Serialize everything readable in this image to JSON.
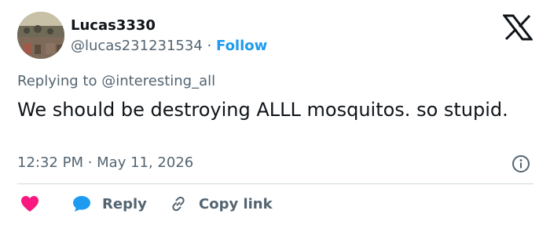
{
  "author": {
    "display_name": "Lucas3330",
    "handle": "@lucas231231534",
    "separator": "·",
    "follow_label": "Follow"
  },
  "reply_context": {
    "prefix": "Replying to",
    "target": "@interesting_all"
  },
  "tweet": {
    "text": "We should be destroying ALLL mosquitos. so stupid.",
    "timestamp": "12:32 PM · May 11, 2026"
  },
  "actions": {
    "reply_label": "Reply",
    "copy_link_label": "Copy link"
  },
  "colors": {
    "accent": "#1d9bf0",
    "heart": "#f91880",
    "text_secondary": "#536471",
    "divider": "#cfd9de"
  },
  "icons": [
    "x-logo-icon",
    "info-icon",
    "heart-icon",
    "reply-bubble-icon",
    "link-icon"
  ]
}
